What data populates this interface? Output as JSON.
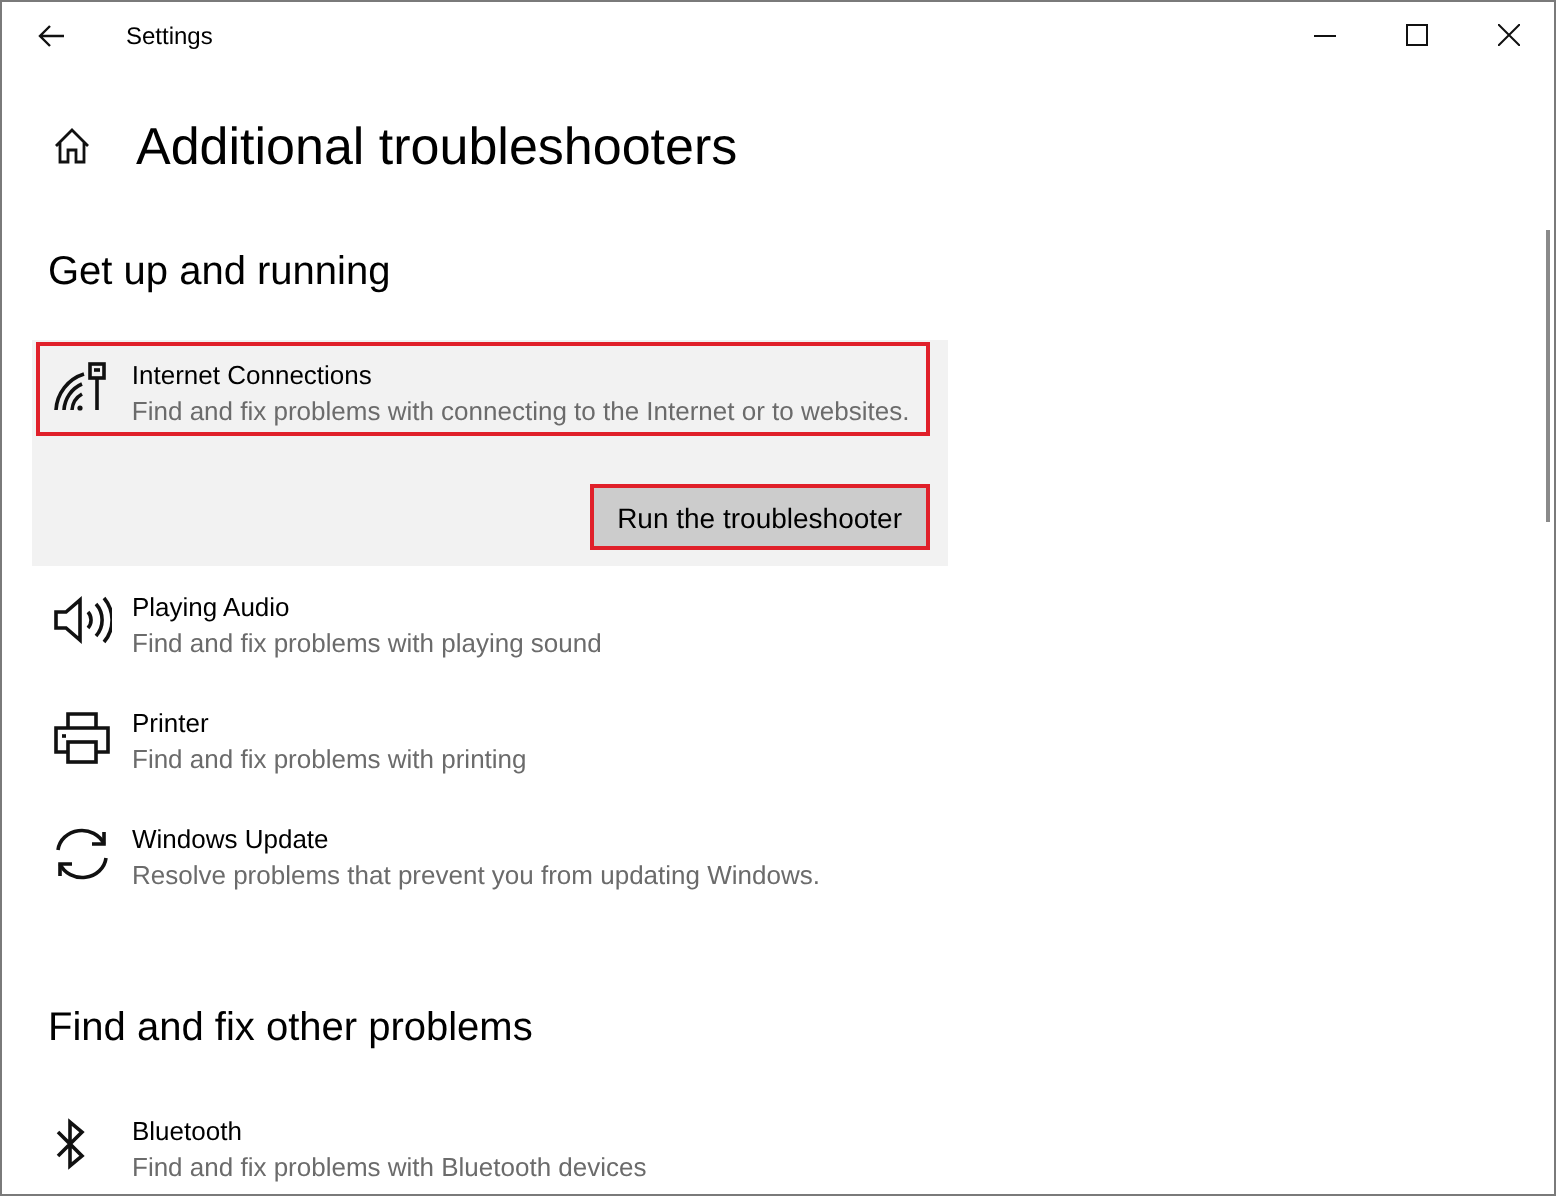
{
  "window": {
    "title": "Settings"
  },
  "page": {
    "title": "Additional troubleshooters"
  },
  "sections": [
    {
      "heading": "Get up and running",
      "items": [
        {
          "kind": "network",
          "title": "Internet Connections",
          "description": "Find and fix problems with connecting to the Internet or to websites.",
          "expanded": true,
          "highlighted": true,
          "button": {
            "label": "Run the troubleshooter",
            "highlighted": true
          }
        },
        {
          "kind": "audio",
          "title": "Playing Audio",
          "description": "Find and fix problems with playing sound",
          "expanded": false,
          "highlighted": false
        },
        {
          "kind": "printer",
          "title": "Printer",
          "description": "Find and fix problems with printing",
          "expanded": false,
          "highlighted": false
        },
        {
          "kind": "update",
          "title": "Windows Update",
          "description": "Resolve problems that prevent you from updating Windows.",
          "expanded": false,
          "highlighted": false
        }
      ]
    },
    {
      "heading": "Find and fix other problems",
      "items": [
        {
          "kind": "bluetooth",
          "title": "Bluetooth",
          "description": "Find and fix problems with Bluetooth devices",
          "expanded": false,
          "highlighted": false
        }
      ]
    }
  ]
}
